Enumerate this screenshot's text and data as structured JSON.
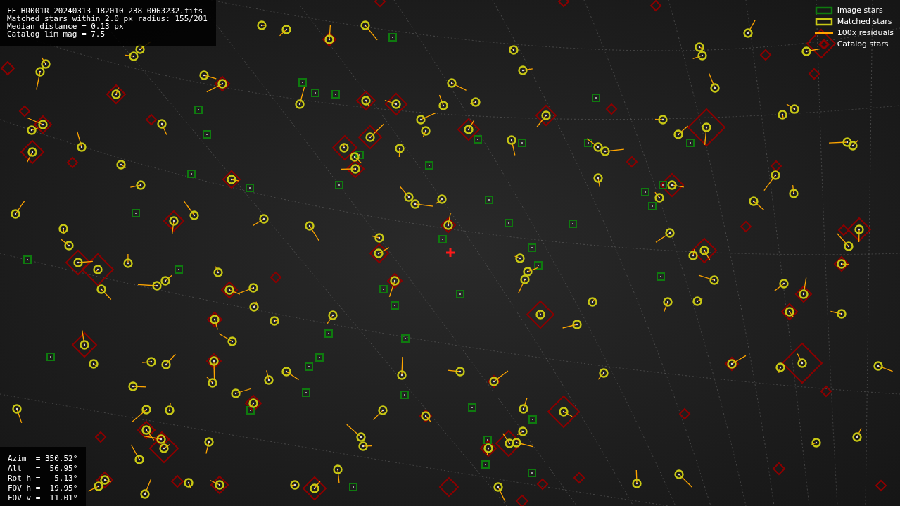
{
  "file_info": {
    "lines": [
      "FF_HR001R_20240313_182010_238_0063232.fits",
      "Matched stars within 2.0 px radius: 155/201",
      "Median distance = 0.13 px",
      "Catalog lim mag = 7.5"
    ]
  },
  "legend": [
    {
      "label": "Image stars",
      "kind": "box",
      "color": "#0f7a0f"
    },
    {
      "label": "Matched stars",
      "kind": "box",
      "color": "#c8c814"
    },
    {
      "label": "100x residuals",
      "kind": "line",
      "color": "#ffa500"
    },
    {
      "label": "Catalog stars",
      "kind": "diamond",
      "color": "#8b0000"
    }
  ],
  "pointing": {
    "lines": [
      "Azim  = 350.52°",
      "Alt   =  56.95°",
      "Rot h =  -5.13°",
      "FOV h =  19.95°",
      "FOV v =  11.01°"
    ]
  }
}
